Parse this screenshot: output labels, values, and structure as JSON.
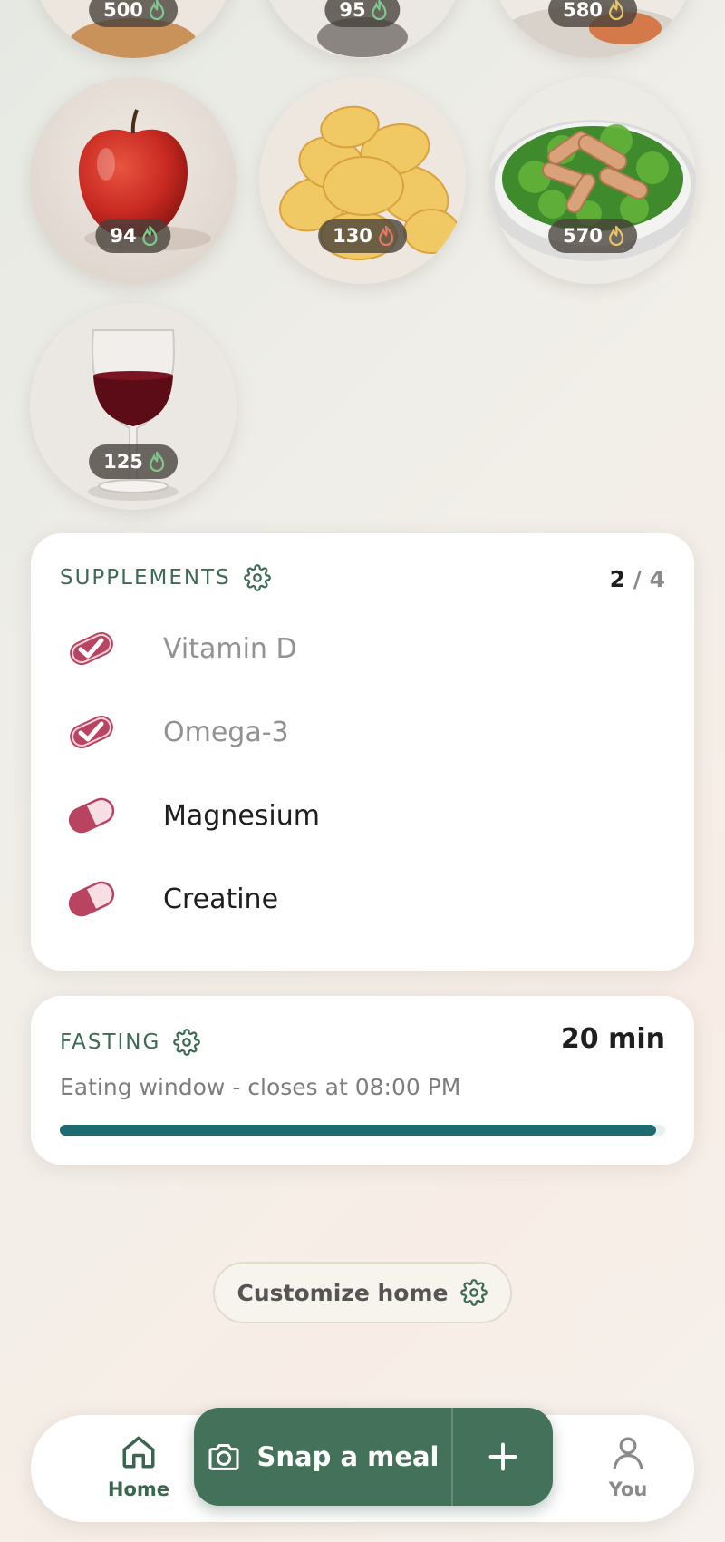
{
  "colors": {
    "accent_green": "#3d6b55",
    "button_green": "#44715a",
    "progress_teal": "#1d6a70",
    "pill_red": "#b94462",
    "flame_green": "#7fc98c",
    "flame_yellow": "#e9c46a",
    "flame_red": "#e07a6a"
  },
  "foods": [
    {
      "calories": "500",
      "icon": "flame-green-icon"
    },
    {
      "calories": "95",
      "icon": "flame-green-icon"
    },
    {
      "calories": "580",
      "icon": "flame-yellow-icon"
    },
    {
      "calories": "94",
      "icon": "flame-green-icon",
      "image": "red apple"
    },
    {
      "calories": "130",
      "icon": "flame-red-icon",
      "image": "potato chips"
    },
    {
      "calories": "570",
      "icon": "flame-yellow-icon",
      "image": "chicken salad"
    },
    {
      "calories": "125",
      "icon": "flame-green-icon",
      "image": "glass of red wine"
    }
  ],
  "supplements": {
    "title": "SUPPLEMENTS",
    "count_taken": "2",
    "count_sep": "/",
    "count_total": "4",
    "items": [
      {
        "name": "Vitamin D",
        "taken": true
      },
      {
        "name": "Omega-3",
        "taken": true
      },
      {
        "name": "Magnesium",
        "taken": false
      },
      {
        "name": "Creatine",
        "taken": false
      }
    ]
  },
  "fasting": {
    "title": "FASTING",
    "time": "20 min",
    "subtitle": "Eating window - closes at 08:00 PM",
    "progress": 0.985
  },
  "customize": {
    "label": "Customize home"
  },
  "nav": {
    "home_label": "Home",
    "snap_label": "Snap a meal",
    "you_label": "You"
  }
}
